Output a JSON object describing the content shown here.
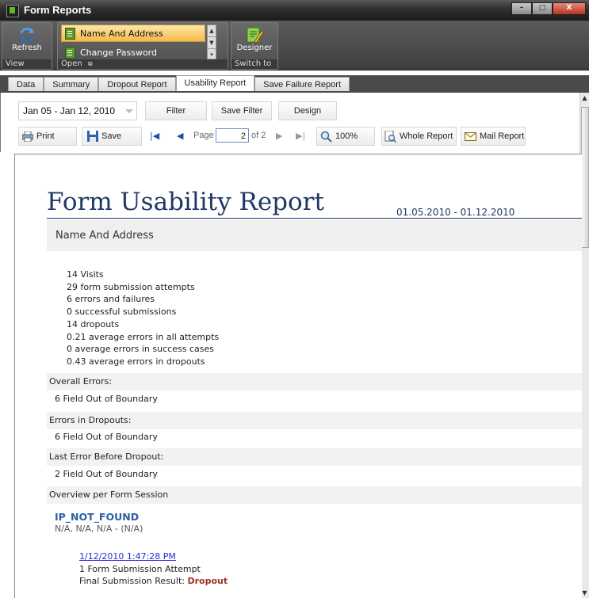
{
  "window": {
    "title": "Form Reports",
    "controls": [
      "–",
      "□",
      "X"
    ]
  },
  "ribbon": {
    "refresh_label": "Refresh",
    "view_group": "View",
    "open_group": "Open",
    "forms": [
      "Name And Address",
      "Change Password"
    ],
    "selected_form": "Name And Address",
    "designer_label": "Designer",
    "switch_group": "Switch to"
  },
  "tabs": [
    "Data",
    "Summary",
    "Dropout Report",
    "Usability Report",
    "Save Failure Report"
  ],
  "active_tab": "Usability Report",
  "toolbar": {
    "date_range": "Jan 05 - Jan 12, 2010",
    "filter": "Filter",
    "save_filter": "Save Filter",
    "design": "Design",
    "print": "Print",
    "save": "Save",
    "page_label": "Page",
    "page_value": "2",
    "page_of": "of 2",
    "zoom": "100%",
    "whole_report": "Whole Report",
    "mail_report": "Mail Report"
  },
  "report": {
    "title": "Form Usability Report",
    "date_range": "01.05.2010 - 01.12.2010",
    "form_name": "Name And Address",
    "stats": [
      "14 Visits",
      "29 form submission attempts",
      "6 errors and failures",
      "0 successful submissions",
      "14 dropouts",
      "0.21 average errors in all attempts",
      "0 average errors in success cases",
      "0.43 average errors in dropouts"
    ],
    "sections": [
      {
        "header": "Overall Errors:",
        "value": "6 Field Out of Boundary"
      },
      {
        "header": "Errors in Dropouts:",
        "value": "6 Field Out of Boundary"
      },
      {
        "header": "Last Error Before Dropout:",
        "value": "2 Field Out of Boundary"
      }
    ],
    "overview_header": "Overview per Form Session",
    "session": {
      "ip": "IP_NOT_FOUND",
      "location": "N/A, N/A, N/A - (N/A)",
      "timestamp": "1/12/2010 1:47:28 PM",
      "attempts": "1 Form Submission Attempt",
      "result_label": "Final Submission Result:",
      "result_value": "Dropout"
    }
  }
}
